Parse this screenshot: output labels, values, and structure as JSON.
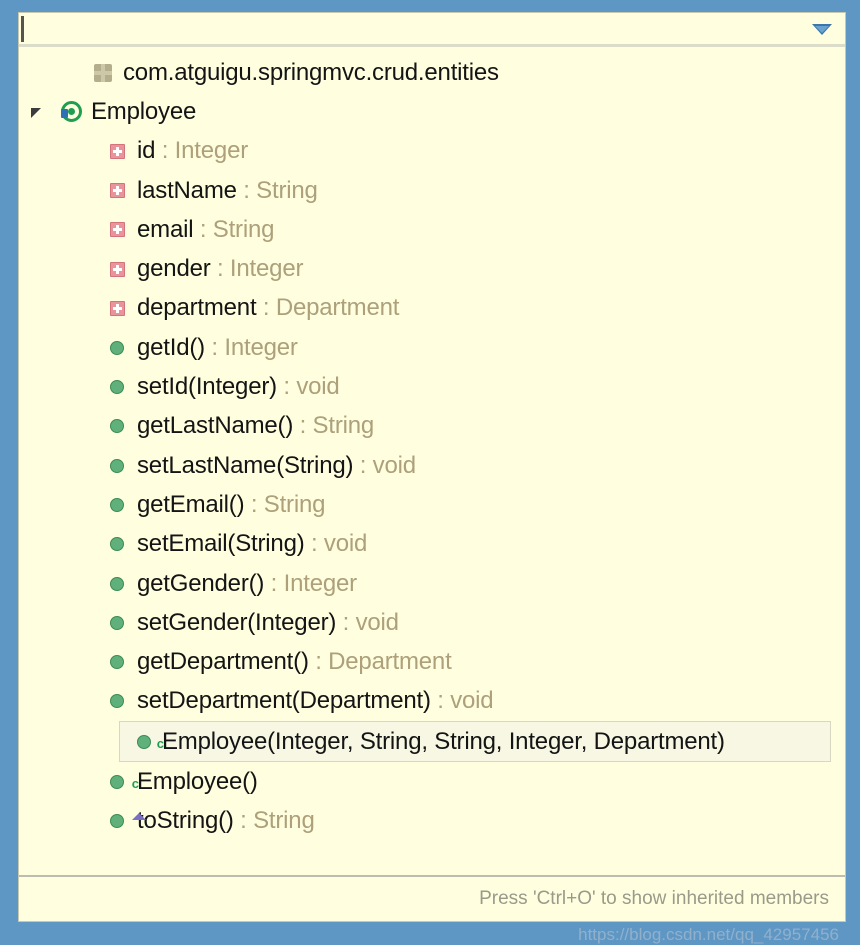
{
  "colors": {
    "frame": "#5e96c4",
    "popup_bg": "#ffffe0",
    "text": "#141414",
    "type_text": "#ada07a",
    "field_icon": "#e8949a",
    "method_icon": "#5fb07a",
    "class_icon": "#1f9e52",
    "footer_text": "#9a9a8a"
  },
  "filter": {
    "value": "",
    "placeholder": "",
    "menu_icon": "chevron-down-icon"
  },
  "tree": {
    "package": {
      "icon": "package-icon",
      "label": "com.atguigu.springmvc.crud.entities"
    },
    "class": {
      "icon": "class-icon",
      "twisty": "expanded-twisty-icon",
      "label": "Employee"
    },
    "members": [
      {
        "kind": "field",
        "icon": "private-field-icon",
        "name": "id",
        "sep": " : ",
        "type": "Integer",
        "selected": false
      },
      {
        "kind": "field",
        "icon": "private-field-icon",
        "name": "lastName",
        "sep": " : ",
        "type": "String",
        "selected": false
      },
      {
        "kind": "field",
        "icon": "private-field-icon",
        "name": "email",
        "sep": " : ",
        "type": "String",
        "selected": false
      },
      {
        "kind": "field",
        "icon": "private-field-icon",
        "name": "gender",
        "sep": " : ",
        "type": "Integer",
        "selected": false
      },
      {
        "kind": "field",
        "icon": "private-field-icon",
        "name": "department",
        "sep": " : ",
        "type": "Department",
        "selected": false
      },
      {
        "kind": "method",
        "icon": "public-method-icon",
        "name": "getId()",
        "sep": " : ",
        "type": "Integer",
        "selected": false
      },
      {
        "kind": "method",
        "icon": "public-method-icon",
        "name": "setId(Integer)",
        "sep": " : ",
        "type": "void",
        "selected": false
      },
      {
        "kind": "method",
        "icon": "public-method-icon",
        "name": "getLastName()",
        "sep": " : ",
        "type": "String",
        "selected": false
      },
      {
        "kind": "method",
        "icon": "public-method-icon",
        "name": "setLastName(String)",
        "sep": " : ",
        "type": "void",
        "selected": false
      },
      {
        "kind": "method",
        "icon": "public-method-icon",
        "name": "getEmail()",
        "sep": " : ",
        "type": "String",
        "selected": false
      },
      {
        "kind": "method",
        "icon": "public-method-icon",
        "name": "setEmail(String)",
        "sep": " : ",
        "type": "void",
        "selected": false
      },
      {
        "kind": "method",
        "icon": "public-method-icon",
        "name": "getGender()",
        "sep": " : ",
        "type": "Integer",
        "selected": false
      },
      {
        "kind": "method",
        "icon": "public-method-icon",
        "name": "setGender(Integer)",
        "sep": " : ",
        "type": "void",
        "selected": false
      },
      {
        "kind": "method",
        "icon": "public-method-icon",
        "name": "getDepartment()",
        "sep": " : ",
        "type": "Department",
        "selected": false
      },
      {
        "kind": "method",
        "icon": "public-method-icon",
        "name": "setDepartment(Department)",
        "sep": " : ",
        "type": "void",
        "selected": false
      },
      {
        "kind": "ctor",
        "icon": "constructor-icon",
        "name": "Employee(Integer, String, String, Integer, Department)",
        "sep": "",
        "type": "",
        "selected": true
      },
      {
        "kind": "ctor",
        "icon": "constructor-icon",
        "name": "Employee()",
        "sep": "",
        "type": "",
        "selected": false
      },
      {
        "kind": "override",
        "icon": "override-method-icon",
        "name": "toString()",
        "sep": " : ",
        "type": "String",
        "selected": false
      }
    ]
  },
  "footer": {
    "hint": "Press 'Ctrl+O' to show inherited members",
    "watermark": "https://blog.csdn.net/qq_42957456"
  }
}
